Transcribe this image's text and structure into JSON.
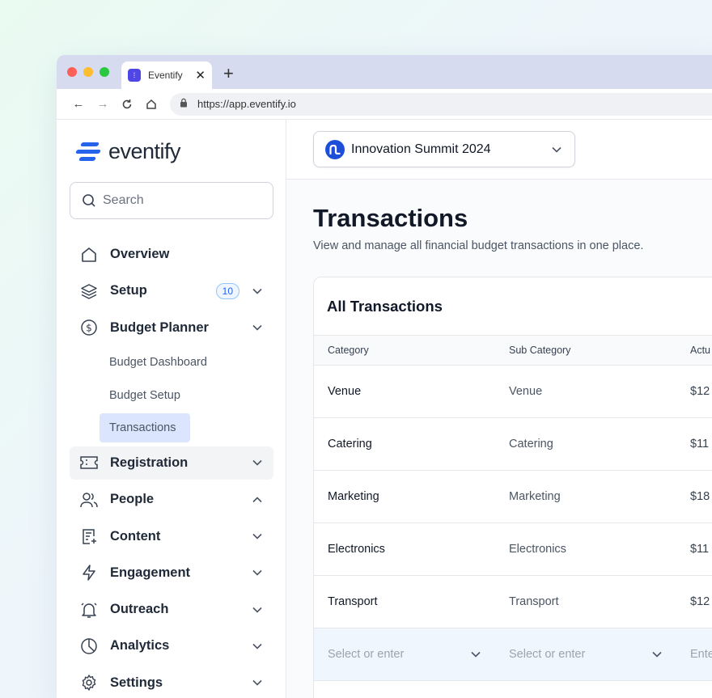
{
  "browser": {
    "tab_title": "Eventify",
    "tab_close": "✕",
    "new_tab": "+",
    "url": "https://app.eventify.io"
  },
  "sidebar": {
    "logo_text": "eventify",
    "search_placeholder": "Search",
    "items": [
      {
        "label": "Overview",
        "icon": "home-icon"
      },
      {
        "label": "Setup",
        "icon": "layers-icon",
        "badge": "10"
      },
      {
        "label": "Budget Planner",
        "icon": "dollar-icon"
      },
      {
        "label": "Registration",
        "icon": "ticket-icon"
      },
      {
        "label": "People",
        "icon": "users-icon"
      },
      {
        "label": "Content",
        "icon": "document-icon"
      },
      {
        "label": "Engagement",
        "icon": "lightning-icon"
      },
      {
        "label": "Outreach",
        "icon": "bell-icon"
      },
      {
        "label": "Analytics",
        "icon": "pie-chart-icon"
      },
      {
        "label": "Settings",
        "icon": "gear-icon"
      }
    ],
    "budget_sub": [
      "Budget Dashboard",
      "Budget Setup",
      "Transactions"
    ]
  },
  "topbar": {
    "event_name": "Innovation Summit 2024"
  },
  "page": {
    "title": "Transactions",
    "subtitle": "View and manage all financial budget transactions in one place."
  },
  "table": {
    "title": "All Transactions",
    "headers": [
      "Category",
      "Sub Category",
      "Actu"
    ],
    "rows": [
      {
        "category": "Venue",
        "sub": "Venue",
        "actual": "$12"
      },
      {
        "category": "Catering",
        "sub": "Catering",
        "actual": "$11"
      },
      {
        "category": "Marketing",
        "sub": "Marketing",
        "actual": "$18"
      },
      {
        "category": "Electronics",
        "sub": "Electronics",
        "actual": "$11"
      },
      {
        "category": "Transport",
        "sub": "Transport",
        "actual": "$12"
      }
    ],
    "input_row": {
      "cat_placeholder": "Select or enter",
      "sub_placeholder": "Select or enter",
      "actual_placeholder": "Ente"
    }
  },
  "colors": {
    "accent": "#2563eb",
    "active_bg": "#dbe5fd"
  }
}
